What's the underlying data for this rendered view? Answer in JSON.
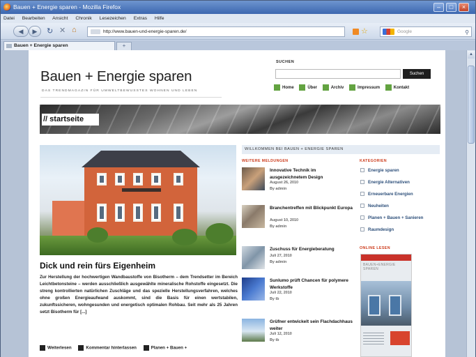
{
  "browser": {
    "window_title": "Bauen + Energie sparen - Mozilla Firefox",
    "menu": [
      "Datei",
      "Bearbeiten",
      "Ansicht",
      "Chronik",
      "Lesezeichen",
      "Extras",
      "Hilfe"
    ],
    "url": "http://www.bauen-und-energie-sparen.de/",
    "search_engine_placeholder": "Google",
    "tab_title": "Bauen + Energie sparen",
    "new_tab_label": "+"
  },
  "site": {
    "title": "Bauen + Energie sparen",
    "tagline": "DAS TRENDMAGAZIN FÜR UMWELTBEWUSSTES WOHNEN UND LEBEN",
    "search_label": "SUCHEN",
    "search_button": "Suchen",
    "nav": [
      "Home",
      "Über",
      "Archiv",
      "Impressum",
      "Kontakt"
    ],
    "nav_icon_color": "#63a341",
    "banner_title": "// startseite"
  },
  "post": {
    "title": "Dick und rein fürs Eigenheim",
    "excerpt": "Zur Herstellung der hochwertigen Wandbaustoffe von Bisotherm – dem Trendsetter im Bereich Leichtbetonsteine – werden ausschließlich ausgewählte mineralische Rohstoffe eingesetzt. Die streng kontrollierten natürlichen Zuschläge und das spezielle Herstellungsverfahren, welches ohne großen Energieaufwand auskommt, sind die Basis für einen wertstabilen, zukunftssicheren, wohngesunden und energetisch optimalen Rohbau. Seit mehr als 25 Jahren setzt Bisotherm für [...]",
    "links": [
      "Weiterlesen",
      "Kommentar hinterlassen",
      "Planen + Bauen +"
    ]
  },
  "sidebar": {
    "welcome": "WILLKOMMEN BEI BAUEN + ENERGIE SPAREN",
    "news_heading": "WEITERE MELDUNGEN",
    "news": [
      {
        "title": "Innovative Technik im ausgezeichnetem Design",
        "date": "August 26, 2010",
        "author": "By admin"
      },
      {
        "title": "Branchentreffen mit Blickpunkt Europa",
        "date": "August 10, 2010",
        "author": "By admin"
      },
      {
        "title": "Zuschuss für Energieberatung",
        "date": "Juli 27, 2010",
        "author": "By admin"
      },
      {
        "title": "Sunlumo prüft Chancen für polymere Werkstoffe",
        "date": "Juli 22, 2010",
        "author": "By tb"
      },
      {
        "title": "Grüfner entwickelt sein Flachdachhaus weiter",
        "date": "Juli 12, 2010",
        "author": "By tb"
      }
    ],
    "categories_heading": "KATEGORIEN",
    "categories": [
      "Energie sparen",
      "Energie Alternativen",
      "Erneuerbare Energien",
      "Neuheiten",
      "Planen + Bauen + Sanieren",
      "Raumdesign"
    ],
    "online_heading": "ONLINE LESEN",
    "magazine_title": "BAUEN+ENERGIE SPAREN"
  },
  "colors": {
    "accent_red": "#cc3a1a",
    "category_blue": "#2d4f7a"
  }
}
